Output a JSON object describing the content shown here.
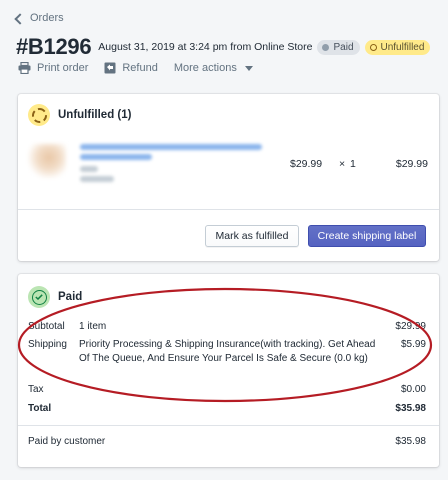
{
  "nav": {
    "back_label": "Orders"
  },
  "order": {
    "number": "#B1296",
    "date_line": "August 31, 2019 at 3:24 pm from Online Store",
    "badges": {
      "payment": "Paid",
      "fulfillment": "Unfulfilled"
    }
  },
  "actions": {
    "print": "Print order",
    "refund": "Refund",
    "more": "More actions"
  },
  "fulfillment_card": {
    "title": "Unfulfilled (1)",
    "item": {
      "unit_price": "$29.99",
      "times": "×",
      "quantity": "1",
      "total": "$29.99"
    },
    "buttons": {
      "mark_fulfilled": "Mark as fulfilled",
      "create_label": "Create shipping label"
    }
  },
  "payment_card": {
    "title": "Paid",
    "rows": {
      "subtotal": {
        "label": "Subtotal",
        "desc": "1 item",
        "value": "$29.99"
      },
      "shipping": {
        "label": "Shipping",
        "desc": "Priority Processing & Shipping Insurance(with tracking). Get Ahead Of The Queue, And Ensure Your Parcel Is Safe & Secure (0.0 kg)",
        "value": "$5.99"
      },
      "tax": {
        "label": "Tax",
        "value": "$0.00"
      },
      "total": {
        "label": "Total",
        "value": "$35.98"
      },
      "paid_by_customer": {
        "label": "Paid by customer",
        "value": "$35.98"
      }
    }
  },
  "colors": {
    "primary_button": "#5c6ac4",
    "unfulfilled_badge": "#ffea8a",
    "paid_status": "#bbe5b3",
    "annotation_ellipse": "#b51c24"
  },
  "icons": {
    "back": "chevron-left-icon",
    "print": "printer-icon",
    "refund": "refund-icon",
    "more": "caret-down-icon",
    "unfulfilled": "dashed-circle-icon",
    "paid": "check-circle-icon"
  }
}
